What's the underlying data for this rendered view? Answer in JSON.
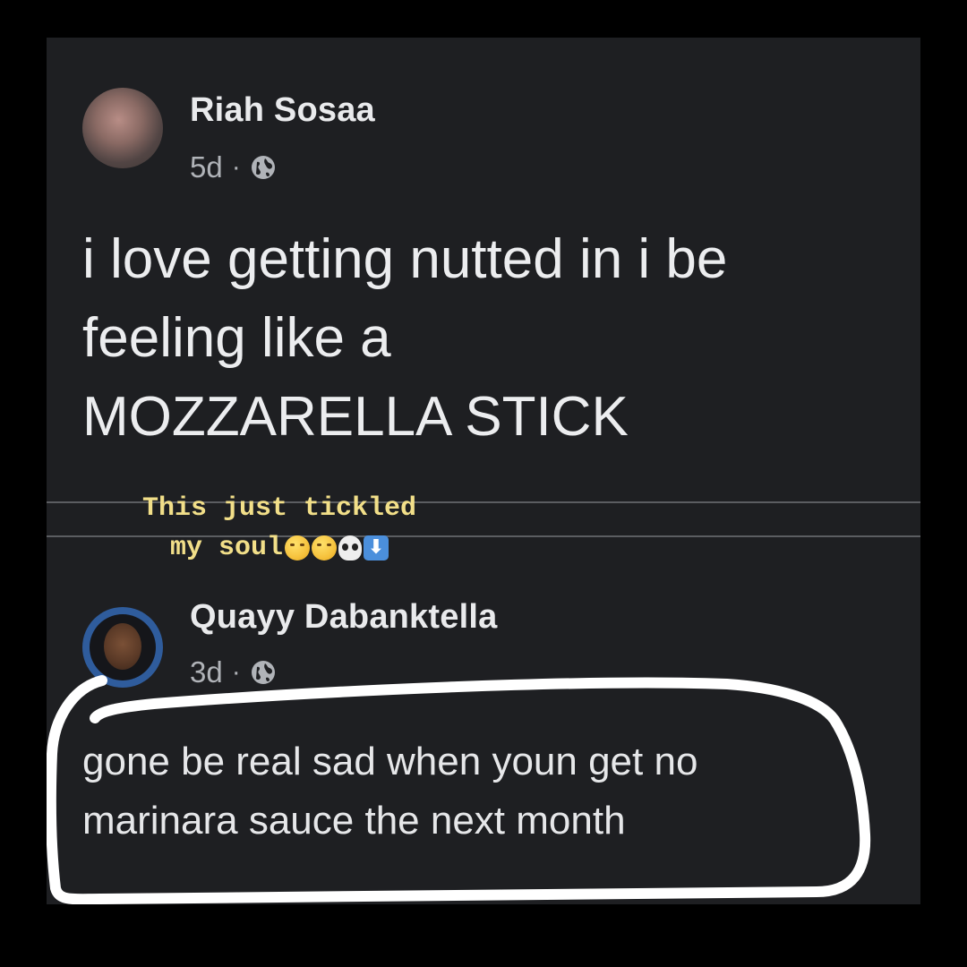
{
  "post": {
    "author": "Riah Sosaa",
    "time": "5d",
    "separator": "·",
    "privacy_icon": "globe-icon",
    "text_lines": [
      "i love getting nutted in i be",
      "feeling like a",
      "MOZZARELLA STICK"
    ]
  },
  "caption": {
    "line1": "This just tickled",
    "line2": "my soul",
    "emojis": [
      "rolling-on-floor-laughing",
      "rolling-on-floor-laughing",
      "skull",
      "down-arrow"
    ]
  },
  "comment": {
    "author": "Quayy Dabanktella",
    "time": "3d",
    "separator": "·",
    "privacy_icon": "globe-icon",
    "text_lines": [
      "gone be real sad when youn get no",
      "marinara sauce the next month"
    ]
  },
  "colors": {
    "background": "#000000",
    "panel": "#1e1f22",
    "caption_text": "#f2df89",
    "avatar_ring": "#2f5c9c",
    "highlight_stroke": "#ffffff"
  }
}
